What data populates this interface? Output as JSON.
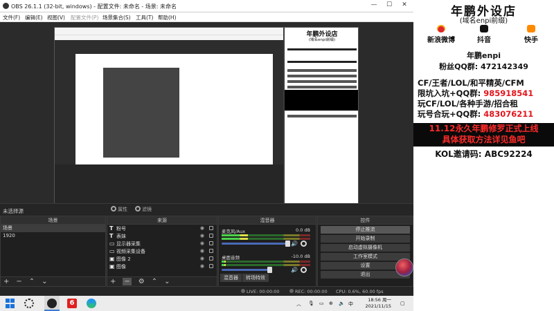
{
  "obs": {
    "title": "OBS 26.1.1 (32-bit, windows) - 配置文件: 未命名 - 场景: 未命名",
    "menu": [
      "文件(F)",
      "编辑(E)",
      "视图(V)",
      "配置文件(P)",
      "场景集合(S)",
      "工具(T)",
      "帮助(H)"
    ],
    "no_source": "未选择源",
    "properties_label": "属性",
    "filters_label": "滤镜",
    "docks": {
      "scenes": {
        "title": "场景",
        "items": [
          "场景",
          "1920"
        ]
      },
      "sources": {
        "title": "来源",
        "items": [
          {
            "icon": "text-icon",
            "glyph": "T",
            "name": "粉号"
          },
          {
            "icon": "text-icon",
            "glyph": "T",
            "name": "表妹"
          },
          {
            "icon": "monitor-icon",
            "glyph": "▭",
            "name": "显示器采集"
          },
          {
            "icon": "camera-icon",
            "glyph": "▭",
            "name": "视频采集设备"
          },
          {
            "icon": "image-icon",
            "glyph": "▣",
            "name": "图像 2"
          },
          {
            "icon": "image-icon",
            "glyph": "▣",
            "name": "图像"
          }
        ]
      },
      "mixer": {
        "title": "混音器",
        "tracks": [
          {
            "name": "麦克风/Aux",
            "db": "0.0 dB",
            "level": 0.3
          },
          {
            "name": "桌面音频",
            "db": "-10.0 dB",
            "level": 0.05
          }
        ],
        "tabs": [
          "混音器",
          "转场特效"
        ]
      },
      "controls": {
        "title": "控件",
        "buttons": [
          "停止推流",
          "开始录制",
          "启动虚拟摄像机",
          "工作室模式",
          "设置",
          "退出"
        ]
      }
    },
    "status": {
      "live": "LIVE: 00:00:00",
      "rec": "REC: 00:00:00",
      "cpu": "CPU: 0.6%, 60.00 fps"
    }
  },
  "taskbar": {
    "six_label": "6",
    "ime": "中",
    "time": "18:56 周一",
    "date": "2021/11/15"
  },
  "panel": {
    "title": "年鹏外设店",
    "subtitle": "(域名enpi前缀)",
    "socials": [
      {
        "icon": "weibo-icon",
        "label": "新浪微博"
      },
      {
        "icon": "douyin-icon",
        "label": "抖音"
      },
      {
        "icon": "kuaishou-icon",
        "label": "快手"
      }
    ],
    "name": "年鹏enpi",
    "fans_qq": "粉丝QQ群: 472142349",
    "cf_line1": "CF/王者/LOL/和平精英/CFM",
    "cf_line2_prefix": "限坑入坑+QQ群: ",
    "cf_line2_num": "985918541",
    "cf_line3": "玩CF/LOL/各种手游/招合租",
    "cf_line4_prefix": "玩号合玩+QQ群: ",
    "cf_line4_num": "483076211",
    "promo_line1": "11.12永久年鹏修罗正式上线",
    "promo_line2": "具体获取方法详见鱼吧",
    "kol": "KOL邀请码: ABC92224",
    "colors": {
      "accent_red": "#e3161c",
      "promo_bg": "#0a0a0a"
    }
  }
}
